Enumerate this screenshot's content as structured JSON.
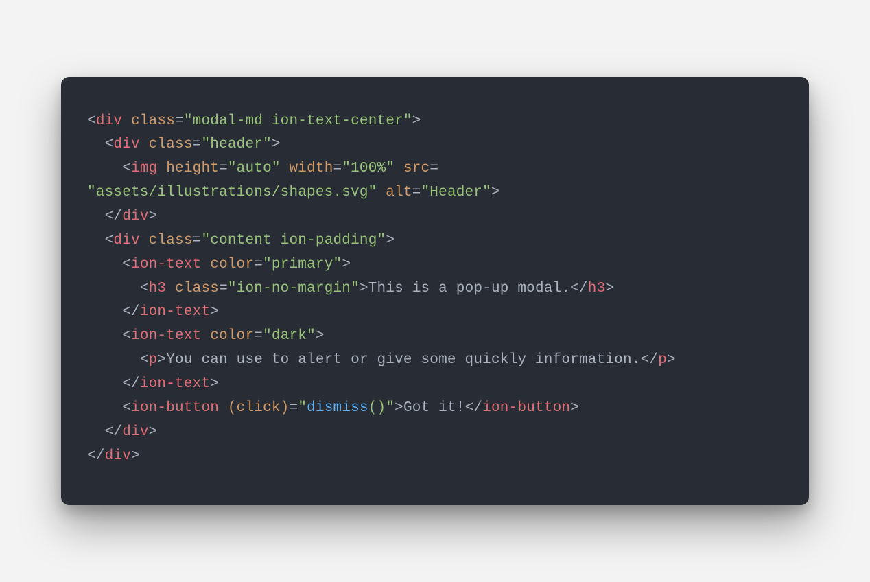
{
  "code": {
    "line1": {
      "tag": "div",
      "attr1": "class",
      "val1": "\"modal-md ion-text-center\""
    },
    "line2": {
      "tag": "div",
      "attr1": "class",
      "val1": "\"header\""
    },
    "line3": {
      "tag": "img",
      "attr1": "height",
      "val1": "\"auto\"",
      "attr2": "width",
      "val2": "\"100%\"",
      "attr3": "src"
    },
    "line4": {
      "val1": "\"assets/illustrations/shapes.svg\"",
      "attr1": "alt",
      "val2": "\"Header\""
    },
    "line5": {
      "tag": "div"
    },
    "line6": {
      "tag": "div",
      "attr1": "class",
      "val1": "\"content ion-padding\""
    },
    "line7": {
      "tag": "ion-text",
      "attr1": "color",
      "val1": "\"primary\""
    },
    "line8": {
      "tag": "h3",
      "attr1": "class",
      "val1": "\"ion-no-margin\"",
      "text": "This is a pop-up modal.",
      "closeTag": "h3"
    },
    "line9": {
      "tag": "ion-text"
    },
    "line10": {
      "tag": "ion-text",
      "attr1": "color",
      "val1": "\"dark\""
    },
    "line11": {
      "tag": "p",
      "text": "You can use to alert or give some quickly information.",
      "closeTag": "p"
    },
    "line12": {
      "tag": "ion-text"
    },
    "line13": {
      "tag": "ion-button",
      "attr1": "(click)",
      "func": "dismiss",
      "parens": "()\"",
      "text": "Got it!",
      "closeTag": "ion-button"
    },
    "line14": {
      "tag": "div"
    },
    "line15": {
      "tag": "div"
    }
  }
}
